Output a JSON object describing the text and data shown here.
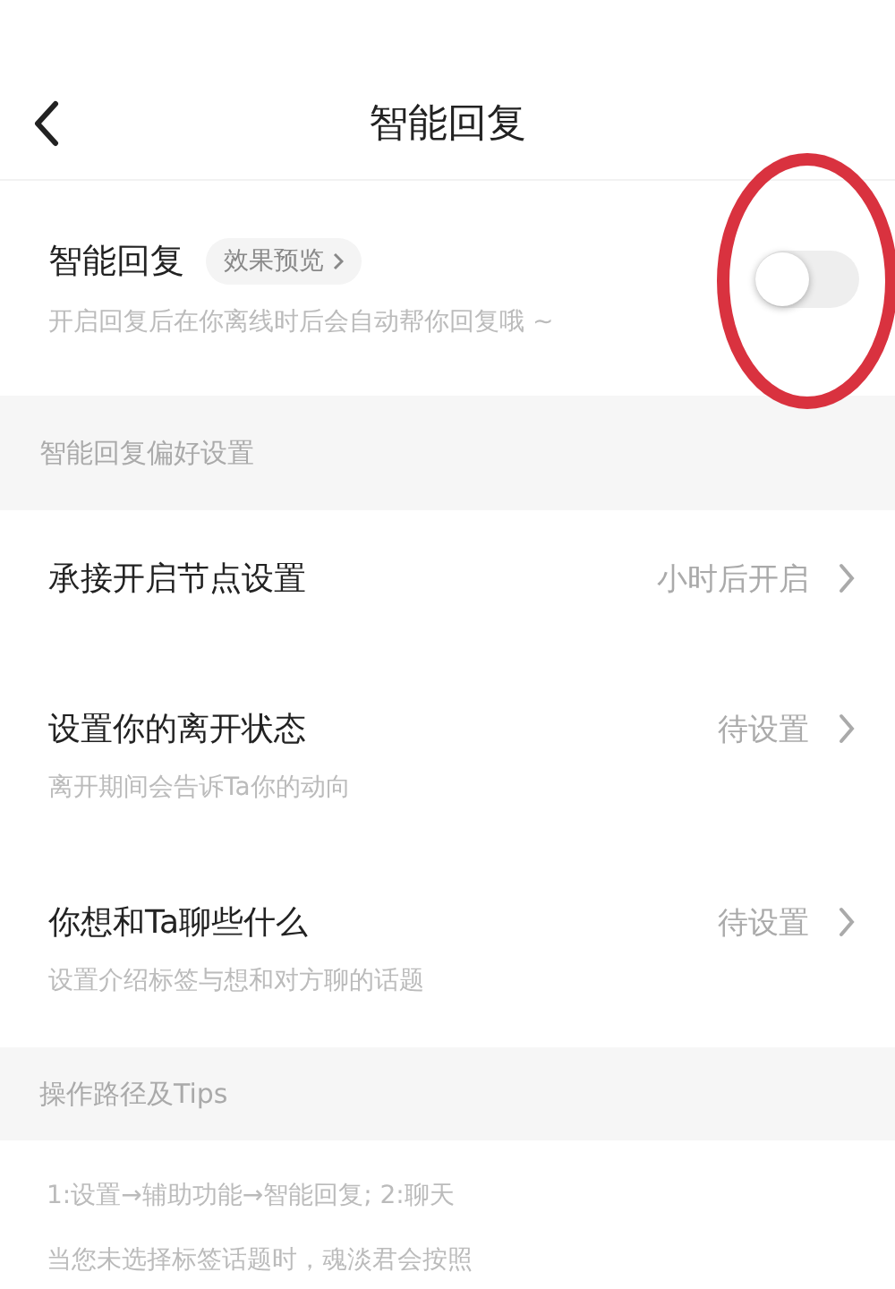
{
  "header": {
    "title": "智能回复"
  },
  "main_setting": {
    "label": "智能回复",
    "preview": "效果预览",
    "on": false,
    "description": "开启回复后在你离线时后会自动帮你回复哦 ~"
  },
  "annotation": {
    "kind": "circle",
    "color": "#d9323f"
  },
  "preferences": {
    "heading": "智能回复偏好设置",
    "rows": [
      {
        "label": "承接开启节点设置",
        "value": "小时后开启"
      },
      {
        "label": "设置你的离开状态",
        "value": "待设置",
        "description": "离开期间会告诉Ta你的动向"
      },
      {
        "label": "你想和Ta聊些什么",
        "value": "待设置",
        "description": "设置介绍标签与想和对方聊的话题"
      }
    ]
  },
  "tips": {
    "heading": "操作路径及Tips",
    "lines": [
      "1:设置→辅助功能→智能回复; 2:聊天",
      "当您未选择标签话题时，魂淡君会按照"
    ]
  }
}
